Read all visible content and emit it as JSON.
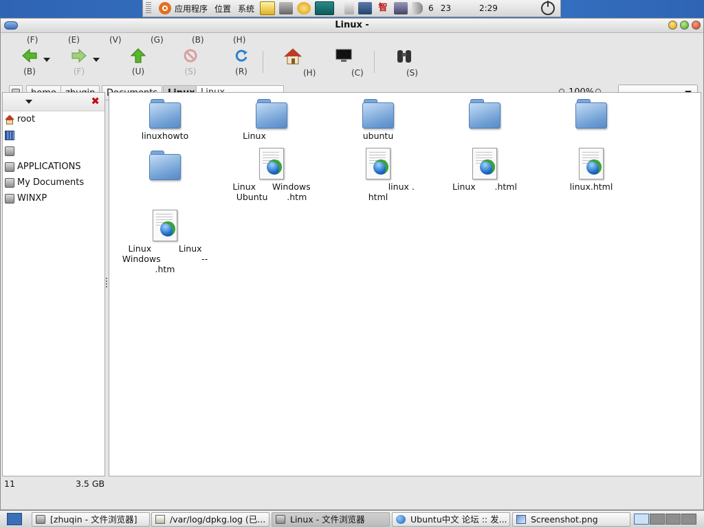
{
  "top_panel": {
    "apps_menu": "应用程序",
    "places_menu": "位置",
    "system_menu": "系统",
    "date_month": "6",
    "date_day": "23",
    "clock": "2:29"
  },
  "window": {
    "title": "Linux -",
    "menu": [
      "(F)",
      "(E)",
      "(V)",
      "(G)",
      "(B)",
      "(H)"
    ],
    "toolbar": {
      "back": "(B)",
      "forward": "(F)",
      "up": "(U)",
      "stop": "(S)",
      "reload": "(R)",
      "home": "(H)",
      "computer": "(C)",
      "search": "(S)"
    },
    "path": [
      "home",
      "zhuqin",
      "Documents",
      "Linux"
    ],
    "location_value": "Linux",
    "zoom": "100%",
    "view_select": ""
  },
  "sidebar": {
    "items": [
      {
        "label": "root",
        "icon": "home-icon"
      },
      {
        "label": "",
        "icon": "film-icon"
      },
      {
        "label": "",
        "icon": "drive-icon"
      },
      {
        "label": "APPLICATIONS",
        "icon": "drive-icon"
      },
      {
        "label": "My Documents",
        "icon": "drive-icon"
      },
      {
        "label": "WINXP",
        "icon": "drive-icon"
      }
    ]
  },
  "files": [
    {
      "name": "linuxhowto",
      "type": "folder-icon"
    },
    {
      "name": "Linux",
      "type": "folder-icon"
    },
    {
      "name": "ubuntu",
      "type": "folder-icon"
    },
    {
      "name": "",
      "type": "folder-icon"
    },
    {
      "name": "",
      "type": "folder-icon"
    },
    {
      "name": "",
      "type": "folder-icon"
    },
    {
      "name": "Linux      Windows\nUbuntu       .htm",
      "type": "html-document-icon"
    },
    {
      "name": "                 linux .\nhtml",
      "type": "html-document-icon"
    },
    {
      "name": "Linux       .html",
      "type": "html-document-icon"
    },
    {
      "name": "linux.html",
      "type": "html-document-icon"
    },
    {
      "name": "Linux          Linux\nWindows               --\n.htm",
      "type": "html-document-icon"
    }
  ],
  "status": {
    "count": "11",
    "free_space": "3.5 GB"
  },
  "taskbar": {
    "tasks": [
      {
        "label": "[zhuqin - 文件浏览器]",
        "icon": "folder-icon"
      },
      {
        "label": "/var/log/dpkg.log (已...",
        "icon": "text-editor-icon"
      },
      {
        "label": "Linux - 文件浏览器",
        "icon": "folder-icon"
      },
      {
        "label": "Ubuntu中文 论坛 :: 发...",
        "icon": "globe-icon"
      },
      {
        "label": "Screenshot.png",
        "icon": "image-icon"
      }
    ]
  },
  "colors": {
    "desktop": "#3a78c8",
    "folder": "#6f9fd4",
    "close_x": "#c01010"
  }
}
